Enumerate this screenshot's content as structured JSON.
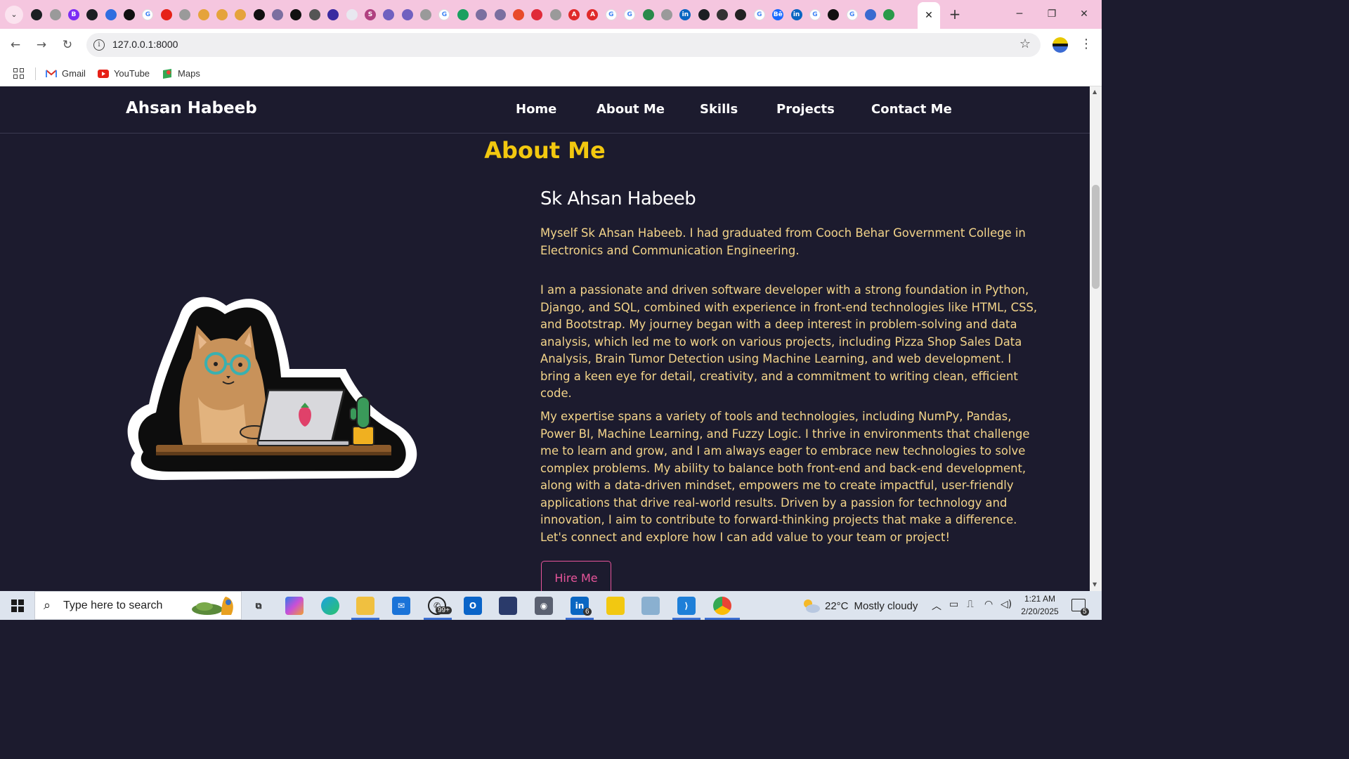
{
  "browser": {
    "favicon_tabs": [
      {
        "name": "github-favicon",
        "color": "#1b1f23",
        "glyph": ""
      },
      {
        "name": "globe-favicon",
        "color": "#9a9a9a",
        "glyph": ""
      },
      {
        "name": "bootstrap-favicon",
        "color": "#7b2cf5",
        "glyph": "B"
      },
      {
        "name": "github-favicon",
        "color": "#1b1f23",
        "glyph": ""
      },
      {
        "name": "flag-favicon",
        "color": "#2f6ee0",
        "glyph": ""
      },
      {
        "name": "openai-favicon",
        "color": "#111111",
        "glyph": ""
      },
      {
        "name": "google-favicon",
        "color": "#ffffff",
        "glyph": "G"
      },
      {
        "name": "youtube-favicon",
        "color": "#e62117",
        "glyph": ""
      },
      {
        "name": "globe-favicon",
        "color": "#9a9a9a",
        "glyph": ""
      },
      {
        "name": "claude-favicon",
        "color": "#e5a33b",
        "glyph": ""
      },
      {
        "name": "claude-favicon",
        "color": "#e5a33b",
        "glyph": ""
      },
      {
        "name": "claude-favicon",
        "color": "#e5a33b",
        "glyph": ""
      },
      {
        "name": "openai-favicon",
        "color": "#111111",
        "glyph": ""
      },
      {
        "name": "app-favicon",
        "color": "#7a6fa0",
        "glyph": ""
      },
      {
        "name": "openai-favicon",
        "color": "#111111",
        "glyph": ""
      },
      {
        "name": "chrome-favicon",
        "color": "#555555",
        "glyph": ""
      },
      {
        "name": "app-favicon",
        "color": "#3a2aa0",
        "glyph": ""
      },
      {
        "name": "app-favicon",
        "color": "#e8e8f0",
        "glyph": ""
      },
      {
        "name": "app-favicon",
        "color": "#b04080",
        "glyph": "S"
      },
      {
        "name": "vercel-favicon",
        "color": "#7060c0",
        "glyph": ""
      },
      {
        "name": "vercel-favicon",
        "color": "#7060c0",
        "glyph": ""
      },
      {
        "name": "globe-favicon",
        "color": "#9a9a9a",
        "glyph": ""
      },
      {
        "name": "google-favicon",
        "color": "#ffffff",
        "glyph": "G"
      },
      {
        "name": "app-favicon",
        "color": "#1aa060",
        "glyph": ""
      },
      {
        "name": "app-favicon",
        "color": "#7a6fa0",
        "glyph": ""
      },
      {
        "name": "app-favicon",
        "color": "#7a6fa0",
        "glyph": ""
      },
      {
        "name": "app-favicon",
        "color": "#e84a2a",
        "glyph": ""
      },
      {
        "name": "app-favicon",
        "color": "#e02a3a",
        "glyph": ""
      },
      {
        "name": "globe-favicon",
        "color": "#9a9a9a",
        "glyph": ""
      },
      {
        "name": "adobe-favicon",
        "color": "#e02a2a",
        "glyph": "A"
      },
      {
        "name": "adobe-favicon",
        "color": "#e02a2a",
        "glyph": "A"
      },
      {
        "name": "google-favicon",
        "color": "#ffffff",
        "glyph": "G"
      },
      {
        "name": "google-favicon",
        "color": "#ffffff",
        "glyph": "G"
      },
      {
        "name": "app-favicon",
        "color": "#2a8a4a",
        "glyph": ""
      },
      {
        "name": "globe-favicon",
        "color": "#9a9a9a",
        "glyph": ""
      },
      {
        "name": "linkedin-favicon",
        "color": "#0a66c2",
        "glyph": "in"
      },
      {
        "name": "github-favicon",
        "color": "#1b1f23",
        "glyph": ""
      },
      {
        "name": "app-favicon",
        "color": "#333333",
        "glyph": ""
      },
      {
        "name": "app-favicon",
        "color": "#222222",
        "glyph": ""
      },
      {
        "name": "google-favicon",
        "color": "#ffffff",
        "glyph": "G"
      },
      {
        "name": "behance-favicon",
        "color": "#1769ff",
        "glyph": "Bē"
      },
      {
        "name": "linkedin-favicon",
        "color": "#0a66c2",
        "glyph": "in"
      },
      {
        "name": "google-favicon",
        "color": "#ffffff",
        "glyph": "G"
      },
      {
        "name": "app-favicon",
        "color": "#111111",
        "glyph": ""
      },
      {
        "name": "google-favicon",
        "color": "#ffffff",
        "glyph": "G"
      },
      {
        "name": "app-favicon",
        "color": "#3a6ad0",
        "glyph": ""
      },
      {
        "name": "drive-favicon",
        "color": "#2a9a4a",
        "glyph": ""
      }
    ],
    "url": "127.0.0.1:8000",
    "bookmarks": [
      {
        "label": "Gmail",
        "icon": "gmail-icon",
        "color": "#d93025"
      },
      {
        "label": "YouTube",
        "icon": "youtube-icon",
        "color": "#e62117"
      },
      {
        "label": "Maps",
        "icon": "maps-icon",
        "color": "#34a853"
      }
    ]
  },
  "site": {
    "brand": "Ahsan Habeeb",
    "nav": [
      {
        "label": "Home"
      },
      {
        "label": "About Me"
      },
      {
        "label": "Skills"
      },
      {
        "label": "Projects"
      },
      {
        "label": "Contact Me"
      }
    ],
    "section_title": "About Me",
    "name": "Sk Ahsan Habeeb",
    "paragraphs": [
      "Myself Sk Ahsan Habeeb. I had graduated from Cooch Behar Government College in Electronics and Communication Engineering.",
      "I am a passionate and driven software developer with a strong foundation in Python, Django, and SQL, combined with experience in front-end technologies like HTML, CSS, and Bootstrap. My journey began with a deep interest in problem-solving and data analysis, which led me to work on various projects, including Pizza Shop Sales Data Analysis, Brain Tumor Detection using Machine Learning, and web development. I bring a keen eye for detail, creativity, and a commitment to writing clean, efficient code.",
      "My expertise spans a variety of tools and technologies, including NumPy, Pandas, Power BI, Machine Learning, and Fuzzy Logic. I thrive in environments that challenge me to learn and grow, and I am always eager to embrace new technologies to solve complex problems. My ability to balance both front-end and back-end development, along with a data-driven mindset, empowers me to create impactful, user-friendly applications that drive real-world results. Driven by a passion for technology and innovation, I aim to contribute to forward-thinking projects that make a difference. Let's connect and explore how I can add value to your team or project!"
    ],
    "hire_button": "Hire Me",
    "colors": {
      "background": "#1c1b2e",
      "accent_title": "#f2c80f",
      "body_text": "#f4d58a",
      "button": "#e8559b"
    }
  },
  "taskbar": {
    "search_placeholder": "Type here to search",
    "whatsapp_badge": "99+",
    "linkedin_badge": "6",
    "weather_temp": "22°C",
    "weather_desc": "Mostly cloudy",
    "time": "1:21 AM",
    "date": "2/20/2025",
    "notification_count": "5"
  }
}
